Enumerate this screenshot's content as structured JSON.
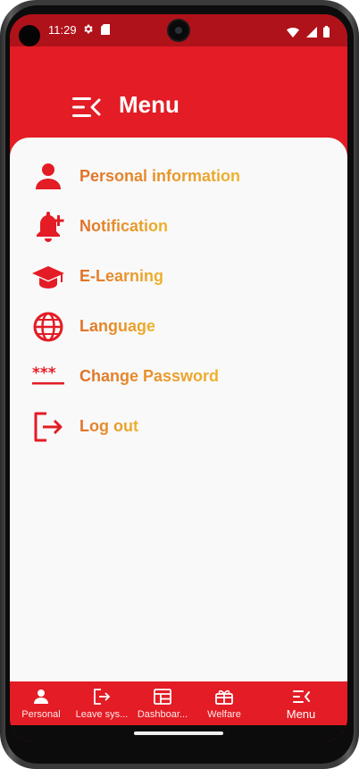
{
  "status_bar": {
    "time": "11:29",
    "icons": [
      "gear-icon",
      "sim-card-icon",
      "wifi-icon",
      "signal-icon",
      "battery-icon"
    ]
  },
  "header": {
    "title": "Menu",
    "icon": "menu-collapse-icon"
  },
  "menu": {
    "items": [
      {
        "label": "Personal information",
        "icon": "person-icon"
      },
      {
        "label": "Notification",
        "icon": "bell-plus-icon"
      },
      {
        "label": "E-Learning",
        "icon": "graduation-cap-icon"
      },
      {
        "label": "Language",
        "icon": "globe-icon"
      },
      {
        "label": "Change Password",
        "icon": "password-icon"
      },
      {
        "label": "Log out",
        "icon": "logout-icon"
      }
    ]
  },
  "bottom_nav": {
    "items": [
      {
        "label": "Personal",
        "icon": "person-icon"
      },
      {
        "label": "Leave sys...",
        "icon": "exit-icon"
      },
      {
        "label": "Dashboar...",
        "icon": "dashboard-icon"
      },
      {
        "label": "Welfare",
        "icon": "gift-icon"
      },
      {
        "label": "Menu",
        "icon": "menu-collapse-icon",
        "active": true
      }
    ]
  },
  "colors": {
    "primary": "#e31c25",
    "status_bar": "#b0121a",
    "background": "#f9f9f9",
    "label_gradient_start": "#e07028",
    "label_gradient_end": "#eeb32e"
  }
}
